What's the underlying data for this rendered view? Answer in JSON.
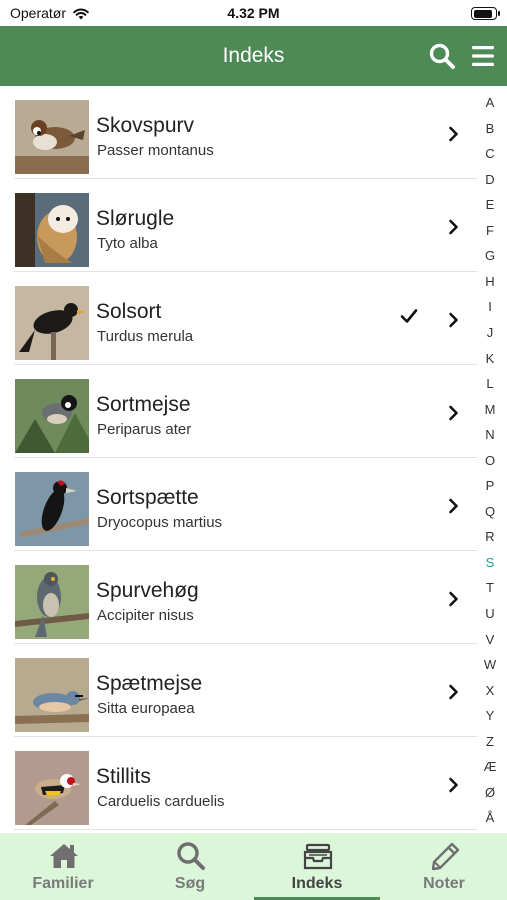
{
  "status": {
    "carrier": "Operatør",
    "time": "4.32 PM",
    "battery_level": 0.9
  },
  "header": {
    "title": "Indeks",
    "search_icon": "search-icon",
    "menu_icon": "hamburger-menu-icon",
    "bar_color": "#4e8a55"
  },
  "birds": [
    {
      "name": "Skovspurv",
      "latin": "Passer montanus",
      "checked": false
    },
    {
      "name": "Slørugle",
      "latin": "Tyto alba",
      "checked": false
    },
    {
      "name": "Solsort",
      "latin": "Turdus merula",
      "checked": true
    },
    {
      "name": "Sortmejse",
      "latin": "Periparus ater",
      "checked": false
    },
    {
      "name": "Sortspætte",
      "latin": "Dryocopus martius",
      "checked": false
    },
    {
      "name": "Spurvehøg",
      "latin": "Accipiter nisus",
      "checked": false
    },
    {
      "name": "Spætmejse",
      "latin": "Sitta europaea",
      "checked": false
    },
    {
      "name": "Stillits",
      "latin": "Carduelis carduelis",
      "checked": false
    }
  ],
  "index_letters": [
    "A",
    "B",
    "C",
    "D",
    "E",
    "F",
    "G",
    "H",
    "I",
    "J",
    "K",
    "L",
    "M",
    "N",
    "O",
    "P",
    "Q",
    "R",
    "S",
    "T",
    "U",
    "V",
    "W",
    "X",
    "Y",
    "Z",
    "Æ",
    "Ø",
    "Å"
  ],
  "index_active": "S",
  "index_active_color": "#2a9ba0",
  "tabs": [
    {
      "label": "Familier",
      "icon": "home-icon"
    },
    {
      "label": "Søg",
      "icon": "search-icon"
    },
    {
      "label": "Indeks",
      "icon": "archive-box-icon",
      "selected": true
    },
    {
      "label": "Noter",
      "icon": "pencil-icon"
    }
  ],
  "tab_bar_color": "#dcf6da"
}
